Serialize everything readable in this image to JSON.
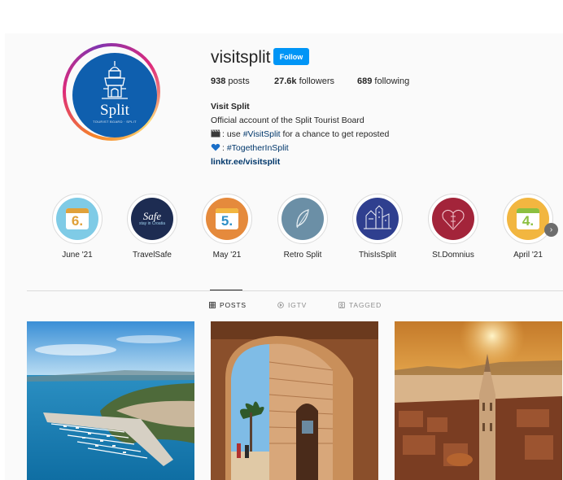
{
  "profile": {
    "username": "visitsplit",
    "follow_label": "Follow",
    "stats": {
      "posts_count": "938",
      "posts_label": " posts",
      "followers_count": "27.6k",
      "followers_label": " followers",
      "following_count": "689",
      "following_label": " following"
    },
    "bio": {
      "name": "Visit Split",
      "line1": "Official account of the Split Tourist Board",
      "line2_prefix": ": use ",
      "line2_tag": "#VisitSplit",
      "line2_suffix": " for a chance to get reposted",
      "line3_prefix": ": ",
      "line3_tag": "#TogetherInSplit",
      "link": "linktr.ee/visitsplit"
    },
    "avatar": {
      "logo_text": "Split",
      "logo_sub": "TOURIST BOARD · SPLIT"
    }
  },
  "highlights": [
    {
      "label": "June '21",
      "art": "6.",
      "bg": "#7fcbe6",
      "numColor": "#e0a13a"
    },
    {
      "label": "TravelSafe",
      "art": "Safe",
      "art_sub": "stay in Croatia",
      "bg": "#1d2c52"
    },
    {
      "label": "May '21",
      "art": "5.",
      "bg": "#e58a3c",
      "numColor": "#2d8fc7"
    },
    {
      "label": "Retro Split",
      "bg": "#6b8fa6"
    },
    {
      "label": "ThisIsSplit",
      "bg": "#2f3f8f"
    },
    {
      "label": "St.Domnius",
      "bg": "#a3243a"
    },
    {
      "label": "April '21",
      "art": "4.",
      "bg": "#f2b640",
      "numColor": "#8cbf3f"
    }
  ],
  "tabs": {
    "posts": "POSTS",
    "igtv": "IGTV",
    "tagged": "TAGGED"
  },
  "colors": {
    "accent": "#0095f6",
    "link": "#00376b",
    "avatar_bg": "#0f5fae"
  },
  "icons": {
    "clapper": "clapper-board-icon",
    "heart": "blue-heart-icon",
    "next": "chevron-right-icon"
  }
}
